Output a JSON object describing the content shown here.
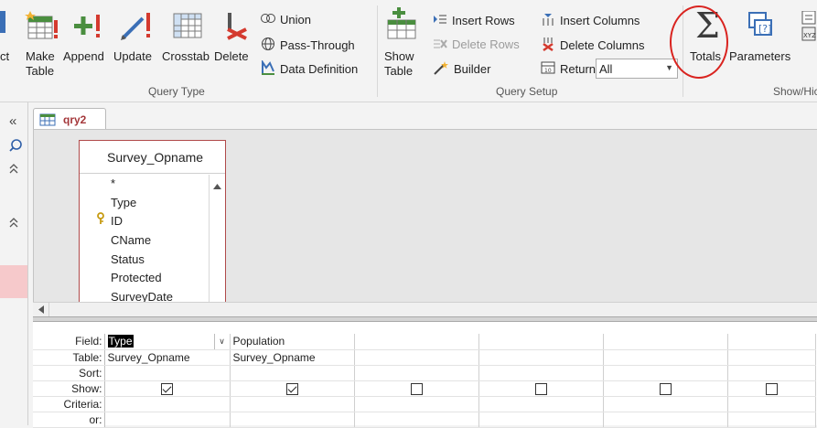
{
  "ribbon": {
    "cut_label": "ct",
    "make_table": {
      "line1": "Make",
      "line2": "Table"
    },
    "append": "Append",
    "update": "Update",
    "crosstab": "Crosstab",
    "delete": "Delete",
    "union": "Union",
    "pass_through": "Pass-Through",
    "data_definition": "Data Definition",
    "show_table": {
      "line1": "Show",
      "line2": "Table"
    },
    "insert_rows": "Insert Rows",
    "delete_rows": "Delete Rows",
    "builder": "Builder",
    "insert_columns": "Insert Columns",
    "delete_columns": "Delete Columns",
    "return_label": "Return:",
    "return_value": "All",
    "totals": "Totals",
    "parameters": "Parameters",
    "group_query_type": "Query Type",
    "group_query_setup": "Query Setup",
    "group_show_hide": "Show/Hic",
    "colors": {
      "accent": "#a4373a",
      "highlight_circle": "#d9231f"
    }
  },
  "nav": {
    "collapse_glyph": "«"
  },
  "tab": {
    "label": "qry2"
  },
  "field_list": {
    "title": "Survey_Opname",
    "items": [
      "*",
      "Type",
      "ID",
      "CName",
      "Status",
      "Protected",
      "SurveyDate"
    ]
  },
  "grid": {
    "row_labels": {
      "field": "Field:",
      "table": "Table:",
      "sort": "Sort:",
      "show": "Show:",
      "criteria": "Criteria:",
      "or": "or:"
    },
    "columns": [
      {
        "field": "Type",
        "table": "Survey_Opname",
        "show": true
      },
      {
        "field": "Population",
        "table": "Survey_Opname",
        "show": true
      },
      {
        "field": "",
        "table": "",
        "show": false
      },
      {
        "field": "",
        "table": "",
        "show": false
      },
      {
        "field": "",
        "table": "",
        "show": false
      },
      {
        "field": "",
        "table": "",
        "show": false
      }
    ]
  }
}
